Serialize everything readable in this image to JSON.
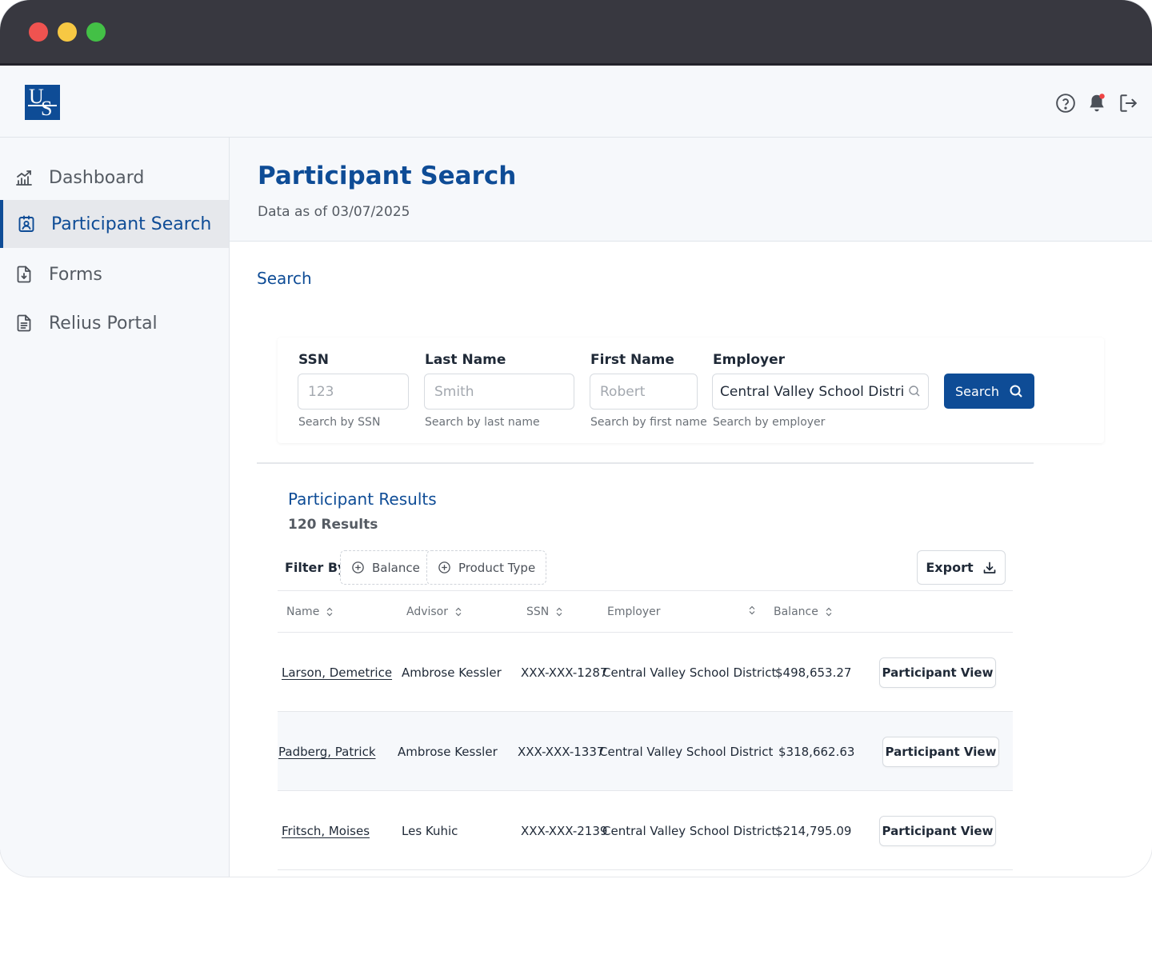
{
  "logo": {
    "line1": "U",
    "line2": "S"
  },
  "topbar": {
    "icons": [
      "help-icon",
      "bell-icon",
      "logout-icon"
    ],
    "notification_dot_color": "#ef4444"
  },
  "sidebar": {
    "items": [
      {
        "label": "Dashboard",
        "icon": "chart-icon",
        "active": false
      },
      {
        "label": "Participant Search",
        "icon": "id-badge-icon",
        "active": true
      },
      {
        "label": "Forms",
        "icon": "file-download-icon",
        "active": false
      },
      {
        "label": "Relius Portal",
        "icon": "document-icon",
        "active": false
      }
    ]
  },
  "page": {
    "title": "Participant Search",
    "subtitle": "Data as of 03/07/2025"
  },
  "search": {
    "section_title": "Search",
    "fields": [
      {
        "label": "SSN",
        "placeholder": "123",
        "value": "",
        "help": "Search by SSN"
      },
      {
        "label": "Last Name",
        "placeholder": "Smith",
        "value": "",
        "help": "Search by last name"
      },
      {
        "label": "First Name",
        "placeholder": "Robert",
        "value": "",
        "help": "Search by first name"
      },
      {
        "label": "Employer",
        "placeholder": "",
        "value": "Central Valley School District",
        "help": "Search by employer"
      }
    ],
    "button_label": "Search"
  },
  "results": {
    "title": "Participant Results",
    "count": "120 Results",
    "filter_label": "Filter By:",
    "filters": [
      "Balance",
      "Product Type"
    ],
    "export_label": "Export",
    "columns": [
      "Name",
      "Advisor",
      "SSN",
      "Employer",
      "Balance"
    ],
    "rows": [
      {
        "name": "Larson, Demetrice",
        "advisor": "Ambrose Kessler",
        "ssn": "XXX-XXX-1287",
        "employer": "Central Valley School District",
        "balance": "$498,653.27",
        "action": "Participant View"
      },
      {
        "name": "Padberg, Patrick",
        "advisor": "Ambrose Kessler",
        "ssn": "XXX-XXX-1337",
        "employer": "Central Valley School District",
        "balance": "$318,662.63",
        "action": "Participant View"
      },
      {
        "name": "Fritsch, Moises",
        "advisor": "Les Kuhic",
        "ssn": "XXX-XXX-2139",
        "employer": "Central Valley School District",
        "balance": "$214,795.09",
        "action": "Participant View"
      }
    ]
  },
  "colors": {
    "brand": "#0e4c96",
    "titlebar": "#383840"
  }
}
